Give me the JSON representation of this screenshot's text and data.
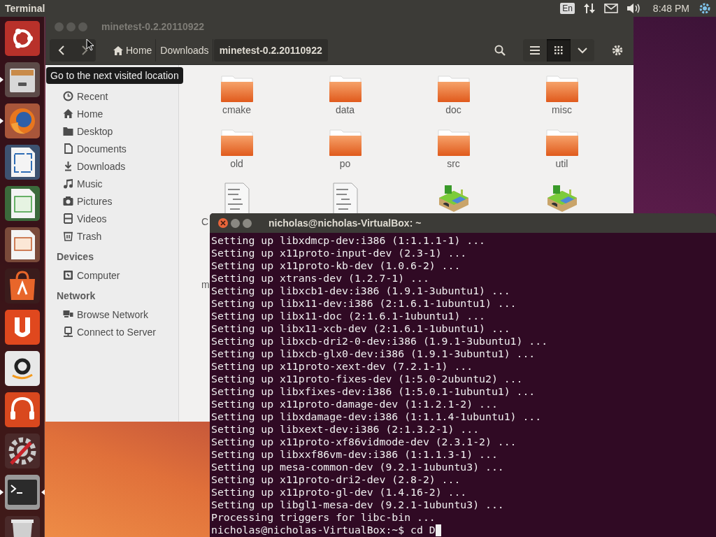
{
  "top_panel": {
    "app_name": "Terminal",
    "keyboard": "En",
    "clock": "8:48 PM"
  },
  "launcher": [
    {
      "kind": "ubuntu",
      "running": false,
      "focused": false
    },
    {
      "kind": "files",
      "running": true,
      "focused": false
    },
    {
      "kind": "firefox",
      "running": true,
      "focused": false
    },
    {
      "kind": "writer",
      "running": false,
      "focused": false
    },
    {
      "kind": "calc",
      "running": false,
      "focused": false
    },
    {
      "kind": "impress",
      "running": false,
      "focused": false
    },
    {
      "kind": "software",
      "running": false,
      "focused": false
    },
    {
      "kind": "ubuntu_one",
      "running": false,
      "focused": false
    },
    {
      "kind": "amazon",
      "running": false,
      "focused": false
    },
    {
      "kind": "music",
      "running": false,
      "focused": false
    },
    {
      "kind": "settings",
      "running": false,
      "focused": false
    },
    {
      "kind": "terminal",
      "running": true,
      "focused": true
    },
    {
      "kind": "trash",
      "running": false,
      "focused": false
    }
  ],
  "file_manager": {
    "title": "minetest-0.2.20110922",
    "path": [
      {
        "label": "Home",
        "kind": "home",
        "selected": false
      },
      {
        "label": "Downloads",
        "kind": "plain",
        "selected": false
      },
      {
        "label": "minetest-0.2.20110922",
        "kind": "plain",
        "selected": true
      }
    ],
    "views": [
      {
        "kind": "list",
        "selected": false
      },
      {
        "kind": "grid",
        "selected": true
      }
    ],
    "tooltip": "Go to the next visited location",
    "sidebar": [
      {
        "kind": "recent",
        "label": "Recent"
      },
      {
        "kind": "home",
        "label": "Home"
      },
      {
        "kind": "desktop",
        "label": "Desktop"
      },
      {
        "kind": "documents",
        "label": "Documents"
      },
      {
        "kind": "downloads",
        "label": "Downloads"
      },
      {
        "kind": "music",
        "label": "Music"
      },
      {
        "kind": "pictures",
        "label": "Pictures"
      },
      {
        "kind": "videos",
        "label": "Videos"
      },
      {
        "kind": "trash",
        "label": "Trash"
      },
      {
        "kind": "heading",
        "label": "Devices"
      },
      {
        "kind": "computer",
        "label": "Computer"
      },
      {
        "kind": "heading",
        "label": "Network"
      },
      {
        "kind": "network",
        "label": "Browse Network"
      },
      {
        "kind": "server",
        "label": "Connect to Server"
      }
    ],
    "files": [
      {
        "kind": "folder",
        "label": "cmake"
      },
      {
        "kind": "folder",
        "label": "data"
      },
      {
        "kind": "folder",
        "label": "doc"
      },
      {
        "kind": "folder",
        "label": "misc"
      },
      {
        "kind": "folder",
        "label": "old"
      },
      {
        "kind": "folder",
        "label": "po"
      },
      {
        "kind": "folder",
        "label": "src"
      },
      {
        "kind": "folder",
        "label": "util"
      },
      {
        "kind": "text",
        "label": "C",
        "clipped": true
      },
      {
        "kind": "text"
      },
      {
        "kind": "app"
      },
      {
        "kind": "app"
      },
      {
        "label": "m",
        "clipped": true
      }
    ]
  },
  "terminal": {
    "title": "nicholas@nicholas-VirtualBox: ~",
    "lines": [
      "Setting up libxdmcp-dev:i386 (1:1.1.1-1) ...",
      "Setting up x11proto-input-dev (2.3-1) ...",
      "Setting up x11proto-kb-dev (1.0.6-2) ...",
      "Setting up xtrans-dev (1.2.7-1) ...",
      "Setting up libxcb1-dev:i386 (1.9.1-3ubuntu1) ...",
      "Setting up libx11-dev:i386 (2:1.6.1-1ubuntu1) ...",
      "Setting up libx11-doc (2:1.6.1-1ubuntu1) ...",
      "Setting up libx11-xcb-dev (2:1.6.1-1ubuntu1) ...",
      "Setting up libxcb-dri2-0-dev:i386 (1.9.1-3ubuntu1) ...",
      "Setting up libxcb-glx0-dev:i386 (1.9.1-3ubuntu1) ...",
      "Setting up x11proto-xext-dev (7.2.1-1) ...",
      "Setting up x11proto-fixes-dev (1:5.0-2ubuntu2) ...",
      "Setting up libxfixes-dev:i386 (1:5.0.1-1ubuntu1) ...",
      "Setting up x11proto-damage-dev (1:1.2.1-2) ...",
      "Setting up libxdamage-dev:i386 (1:1.1.4-1ubuntu1) ...",
      "Setting up libxext-dev:i386 (2:1.3.2-1) ...",
      "Setting up x11proto-xf86vidmode-dev (2.3.1-2) ...",
      "Setting up libxxf86vm-dev:i386 (1:1.1.3-1) ...",
      "Setting up mesa-common-dev (9.2.1-1ubuntu3) ...",
      "Setting up x11proto-dri2-dev (2.8-2) ...",
      "Setting up x11proto-gl-dev (1.4.16-2) ...",
      "Setting up libgl1-mesa-dev (9.2.1-1ubuntu3) ...",
      "Processing triggers for libc-bin ..."
    ],
    "prompt": "nicholas@nicholas-VirtualBox:~$ cd D"
  }
}
